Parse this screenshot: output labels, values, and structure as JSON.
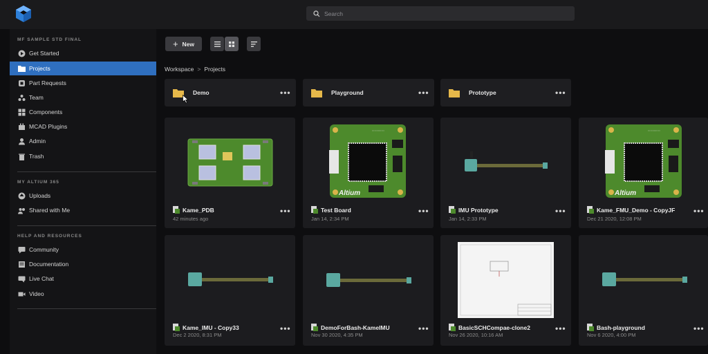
{
  "search": {
    "placeholder": "Search"
  },
  "sidebar": {
    "workspace_heading": "MF SAMPLE STD FINAL",
    "workspace_items": [
      {
        "label": "Get Started",
        "icon": "play-circle-icon"
      },
      {
        "label": "Projects",
        "icon": "folder-icon",
        "active": true
      },
      {
        "label": "Part Requests",
        "icon": "part-request-icon"
      },
      {
        "label": "Team",
        "icon": "team-icon"
      },
      {
        "label": "Components",
        "icon": "components-icon"
      },
      {
        "label": "MCAD Plugins",
        "icon": "plugin-icon"
      },
      {
        "label": "Admin",
        "icon": "admin-icon"
      },
      {
        "label": "Trash",
        "icon": "trash-icon"
      }
    ],
    "personal_heading": "MY ALTIUM 365",
    "personal_items": [
      {
        "label": "Uploads",
        "icon": "upload-icon"
      },
      {
        "label": "Shared with Me",
        "icon": "shared-icon"
      }
    ],
    "help_heading": "HELP AND RESOURCES",
    "help_items": [
      {
        "label": "Community",
        "icon": "community-icon"
      },
      {
        "label": "Documentation",
        "icon": "documentation-icon"
      },
      {
        "label": "Live Chat",
        "icon": "chat-icon"
      },
      {
        "label": "Video",
        "icon": "video-icon"
      }
    ]
  },
  "toolbar": {
    "new_label": "New",
    "plus_glyph": "+"
  },
  "breadcrumb": {
    "root": "Workspace",
    "separator": ">",
    "current": "Projects"
  },
  "more_glyph": "•••",
  "folders": [
    {
      "name": "Demo"
    },
    {
      "name": "Playground"
    },
    {
      "name": "Prototype"
    }
  ],
  "projects": [
    {
      "name": "Kame_PDB",
      "date": "42 minutes ago",
      "thumb": "pcb-board-green"
    },
    {
      "name": "Test Board",
      "date": "Jan 14, 2:34 PM",
      "thumb": "pcb-chip-board"
    },
    {
      "name": "IMU Prototype",
      "date": "Jan 14, 2:33 PM",
      "thumb": "flex-cable"
    },
    {
      "name": "Kame_FMU_Demo - CopyJF",
      "date": "Dec 21 2020, 12:08 PM",
      "thumb": "pcb-chip-board"
    },
    {
      "name": "Kame_IMU - Copy33",
      "date": "Dec 2 2020, 8:31 PM",
      "thumb": "flex-cable"
    },
    {
      "name": "DemoForBash-KameIMU",
      "date": "Nov 30 2020, 4:35 PM",
      "thumb": "flex-cable"
    },
    {
      "name": "BasicSCHCompae-clone2",
      "date": "Nov 26 2020, 10:16 AM",
      "thumb": "schematic-sheet"
    },
    {
      "name": "Bash-playground",
      "date": "Nov 6 2020, 4:00 PM",
      "thumb": "flex-cable"
    }
  ],
  "board_silk_text": "Altium",
  "colors": {
    "accent": "#2f6fbf",
    "folder": "#e6b84a",
    "pcb_green": "#4d8a2c",
    "flex": "#6b6a3a"
  }
}
